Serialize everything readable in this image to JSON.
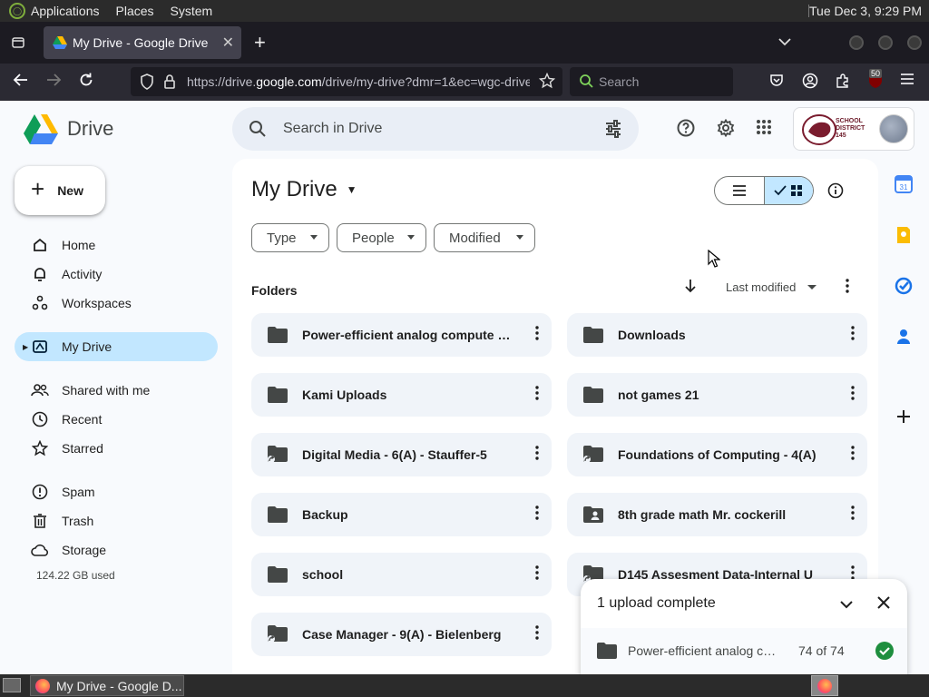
{
  "os": {
    "menus": [
      "Applications",
      "Places",
      "System"
    ],
    "clock": "Tue Dec  3,  9:29 PM"
  },
  "browser": {
    "tab_title": "My Drive - Google Drive",
    "url_prefix": "https://drive.",
    "url_domain": "google.com",
    "url_suffix": "/drive/my-drive?dmr=1&ec=wgc-drive",
    "search_placeholder": "Search",
    "extension_badge": "50"
  },
  "drive": {
    "logo_text": "Drive",
    "search_placeholder": "Search in Drive",
    "org_name_line1": "SCHOOL",
    "org_name_line2": "DISTRICT",
    "org_name_line3": "145",
    "new_label": "New",
    "nav": [
      {
        "label": "Home",
        "icon": "home-icon"
      },
      {
        "label": "Activity",
        "icon": "bell-icon"
      },
      {
        "label": "Workspaces",
        "icon": "workspaces-icon"
      },
      {
        "label": "My Drive",
        "icon": "my-drive-icon"
      },
      {
        "label": "Shared with me",
        "icon": "people-icon"
      },
      {
        "label": "Recent",
        "icon": "clock-icon"
      },
      {
        "label": "Starred",
        "icon": "star-icon"
      },
      {
        "label": "Spam",
        "icon": "spam-icon"
      },
      {
        "label": "Trash",
        "icon": "trash-icon"
      },
      {
        "label": "Storage",
        "icon": "cloud-icon"
      }
    ],
    "storage_used": "124.22 GB used",
    "page_title": "My Drive",
    "filters": [
      "Type",
      "People",
      "Modified"
    ],
    "section_label": "Folders",
    "sort_label": "Last modified",
    "folders": [
      {
        "name": "Power-efficient analog compute for edge AI",
        "type": "folder"
      },
      {
        "name": "Downloads",
        "type": "folder"
      },
      {
        "name": "Kami Uploads",
        "type": "folder"
      },
      {
        "name": "not games 21",
        "type": "folder"
      },
      {
        "name": "Digital Media - 6(A) - Stauffer-5",
        "type": "shortcut-folder"
      },
      {
        "name": "Foundations of Computing - 4(A)",
        "type": "shortcut-folder"
      },
      {
        "name": "Backup",
        "type": "folder"
      },
      {
        "name": "8th grade math Mr. cockerill",
        "type": "shared-folder"
      },
      {
        "name": "school",
        "type": "folder"
      },
      {
        "name": "D145 Assesment Data-Internal U",
        "type": "shortcut-folder"
      },
      {
        "name": "Case Manager - 9(A) - Bielenberg",
        "type": "shortcut-folder"
      }
    ],
    "upload": {
      "title": "1 upload complete",
      "item_name": "Power-efficient analog compute",
      "count": "74 of 74"
    }
  },
  "taskbar": {
    "task_title": "My Drive - Google D..."
  },
  "colors": {
    "accent": "#c2e7ff",
    "success": "#1e8e3e",
    "search_bg": "#e9eef6",
    "folder_bg": "#f0f4f9"
  }
}
